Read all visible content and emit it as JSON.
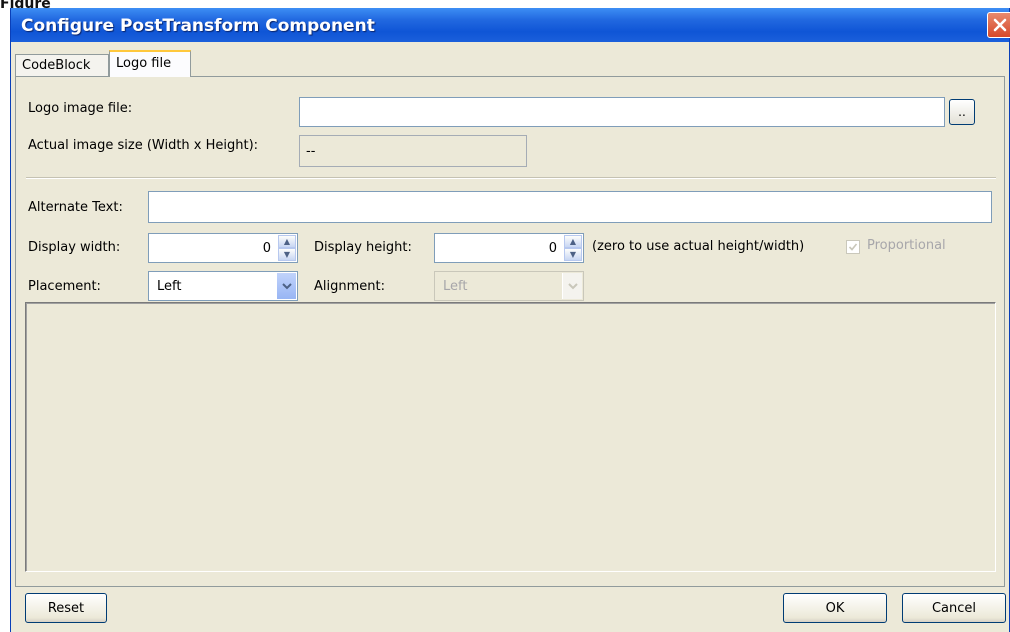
{
  "page_fragment": "Figure",
  "window": {
    "title": "Configure PostTransform Component",
    "close_icon": "close-icon"
  },
  "tabs": [
    {
      "label": "CodeBlock",
      "active": false
    },
    {
      "label": "Logo file",
      "active": true
    }
  ],
  "logo_file": {
    "image_file_label": "Logo image file:",
    "image_file_value": "",
    "browse_label": "..",
    "actual_size_label": "Actual image size (Width x Height):",
    "actual_size_value": "--"
  },
  "display": {
    "alt_text_label": "Alternate Text:",
    "alt_text_value": "",
    "width_label": "Display width:",
    "width_value": "0",
    "height_label": "Display height:",
    "height_value": "0",
    "hint": "(zero to use actual height/width)",
    "proportional_label": "Proportional",
    "proportional_checked": true,
    "proportional_enabled": false,
    "placement_label": "Placement:",
    "placement_value": "Left",
    "alignment_label": "Alignment:",
    "alignment_value": "Left",
    "alignment_enabled": false
  },
  "footer": {
    "reset_label": "Reset",
    "ok_label": "OK",
    "cancel_label": "Cancel"
  },
  "colors": {
    "titlebar": "#0f55d6",
    "dialog_bg": "#ece9d8",
    "close_button": "#d6482a",
    "active_tab_highlight": "#ffc83c"
  }
}
